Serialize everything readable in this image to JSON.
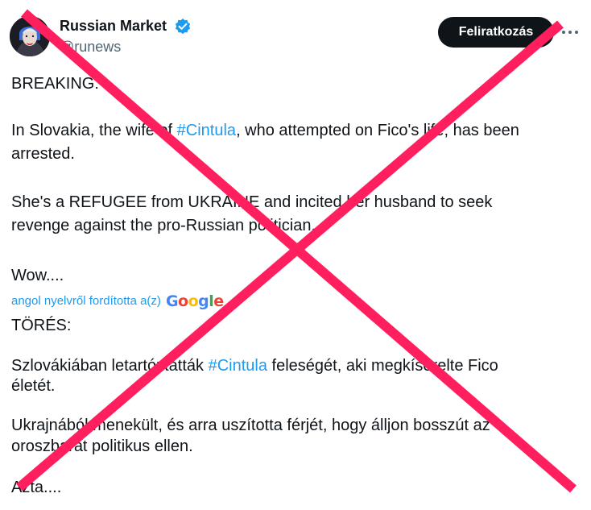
{
  "author": {
    "name": "Russian Market",
    "handle": "@runews"
  },
  "actions": {
    "subscribe_label": "Feliratkozás"
  },
  "original": {
    "line1": "BREAKING:",
    "line2_before": "In Slovakia, the wife of ",
    "line2_hashtag": "#Cintula",
    "line2_after": ", who attempted on Fico's life, has been",
    "line3": "arrested.",
    "line4": "She's a REFUGEE from UKRAINE and incited her husband to seek",
    "line5": "revenge against the pro-Russian politician.",
    "line6": "Wow...."
  },
  "translation": {
    "label": "angol nyelvről fordította a(z)",
    "provider": "Google"
  },
  "translated": {
    "line1": "TÖRÉS:",
    "line2_before": "Szlovákiában letartóztatták ",
    "line2_hashtag": "#Cintula",
    "line2_after": " feleségét, aki megkísérelte Fico",
    "line3": "életét.",
    "line4": "Ukrajnából menekült, és arra uszította férjét, hogy álljon bosszút az",
    "line5": "oroszbarát politikus ellen.",
    "line6": "Azta...."
  },
  "colors": {
    "link": "#1d9bf0",
    "verified": "#1d9bf0",
    "cross": "#ff1f5e",
    "button": "#0f1419"
  },
  "icons": {
    "verified": "verified-badge-icon",
    "more": "more-horizontal-icon"
  }
}
